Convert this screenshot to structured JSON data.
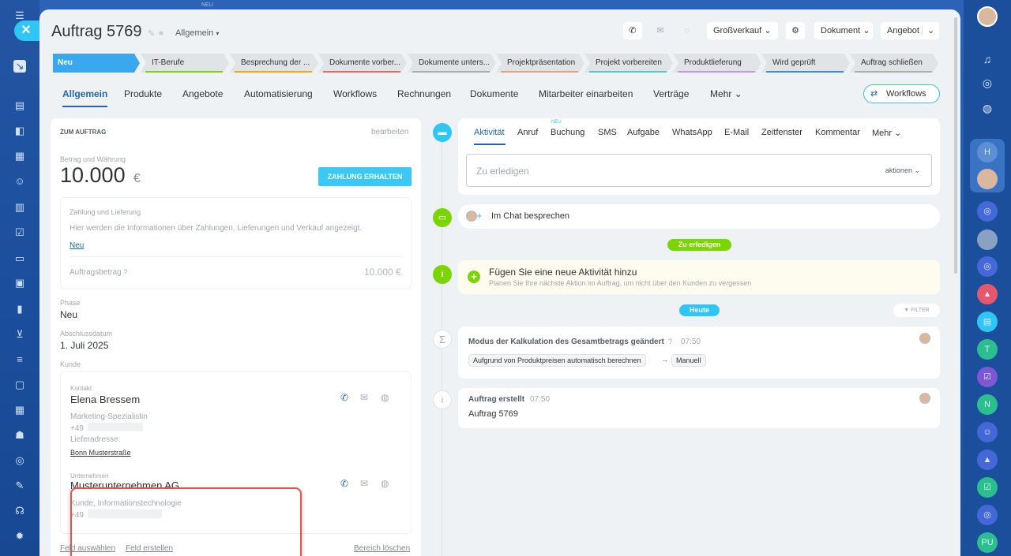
{
  "left_rail": {
    "new_label": "NEU"
  },
  "header": {
    "title": "Auftrag 5769",
    "category": "Allgemein",
    "buttons": {
      "grosshandel": "Großverkauf",
      "dokument": "Dokument",
      "angebot": "Angebot"
    }
  },
  "pipeline": [
    {
      "label": "Neu",
      "color": "#39a8ef"
    },
    {
      "label": "IT-Berufe",
      "color": "#7bd500"
    },
    {
      "label": "Besprechung der ...",
      "color": "#f7a700"
    },
    {
      "label": "Dokumente vorber...",
      "color": "#ee6a5f"
    },
    {
      "label": "Dokumente unters...",
      "color": "#a8adb4"
    },
    {
      "label": "Projektpräsentation",
      "color": "#ef9c7a"
    },
    {
      "label": "Projekt vorbereiten",
      "color": "#4dd0c4"
    },
    {
      "label": "Produktlieferung",
      "color": "#c793e5"
    },
    {
      "label": "Wird geprüft",
      "color": "#3a8ae8"
    },
    {
      "label": "Auftrag schließen",
      "color": "#a8adb4"
    }
  ],
  "tabs": [
    "Allgemein",
    "Produkte",
    "Angebote",
    "Automatisierung",
    "Workflows",
    "Rechnungen",
    "Dokumente",
    "Mitarbeiter einarbeiten",
    "Verträge",
    "Mehr"
  ],
  "workflows_button": "Workflows",
  "left": {
    "section_title": "ZUM AUFTRAG",
    "edit": "bearbeiten",
    "amount_label": "Betrag und Währung",
    "amount": "10.000",
    "currency": "€",
    "pay_button": "ZAHLUNG ERHALTEN",
    "payment_title": "Zahlung und Lieferung",
    "payment_text": "Hier werden die Informationen über Zahlungen, Lieferungen und Verkauf angezeigt.",
    "payment_status": "Neu",
    "order_amount_label": "Auftragsbetrag",
    "order_amount": "10.000 €",
    "phase_label": "Phase",
    "phase": "Neu",
    "close_date_label": "Abschlussdatum",
    "close_date": "1. Juli 2025",
    "client_label": "Kunde",
    "contact_label": "Kontakt",
    "contact_name": "Elena Bressem",
    "contact_role": "Marketing-Spezialistin",
    "contact_phone": "+49",
    "delivery_label": "Lieferadresse:",
    "delivery_address": "Bonn Musterstraße",
    "company_label": "Unternehmen",
    "company_name": "Musterunternehmen AG",
    "company_type": "Kunde, Informationstechnologie",
    "company_phone": "+49",
    "footer_select": "Feld auswählen",
    "footer_create": "Feld erstellen",
    "footer_clear": "Bereich löschen"
  },
  "timeline": {
    "tabs": [
      "Aktivität",
      "Anruf",
      "Buchung",
      "SMS",
      "Aufgabe",
      "WhatsApp",
      "E-Mail",
      "Zeitfenster",
      "Kommentar",
      "Mehr"
    ],
    "new_badge": "NEU",
    "todo_placeholder": "Zu erledigen",
    "actions": "aktionen",
    "chat_label": "Im Chat besprechen",
    "todo_badge": "Zu erledigen",
    "add_activity_title": "Fügen Sie eine neue Aktivität hinzu",
    "add_activity_text": "Planen Sie Ihre nächste Aktion im Auftrag, um nicht über den Kunden zu vergessen",
    "today_badge": "Heute",
    "filter": "FILTER",
    "event1_title": "Modus der Kalkulation des Gesamtbetrags geändert",
    "event1_time": "07:50",
    "event1_from": "Aufgrund von Produktpreisen automatisch berechnen",
    "event1_to": "Manuell",
    "event2_title": "Auftrag erstellt",
    "event2_time": "07:50",
    "event2_text": "Auftrag 5769"
  },
  "right_rail": [
    "T",
    "N",
    "PU"
  ],
  "colors": {
    "accent": "#2066b0",
    "cyan": "#2fc6f6",
    "green": "#7bd500",
    "highlight": "#e0564e"
  }
}
